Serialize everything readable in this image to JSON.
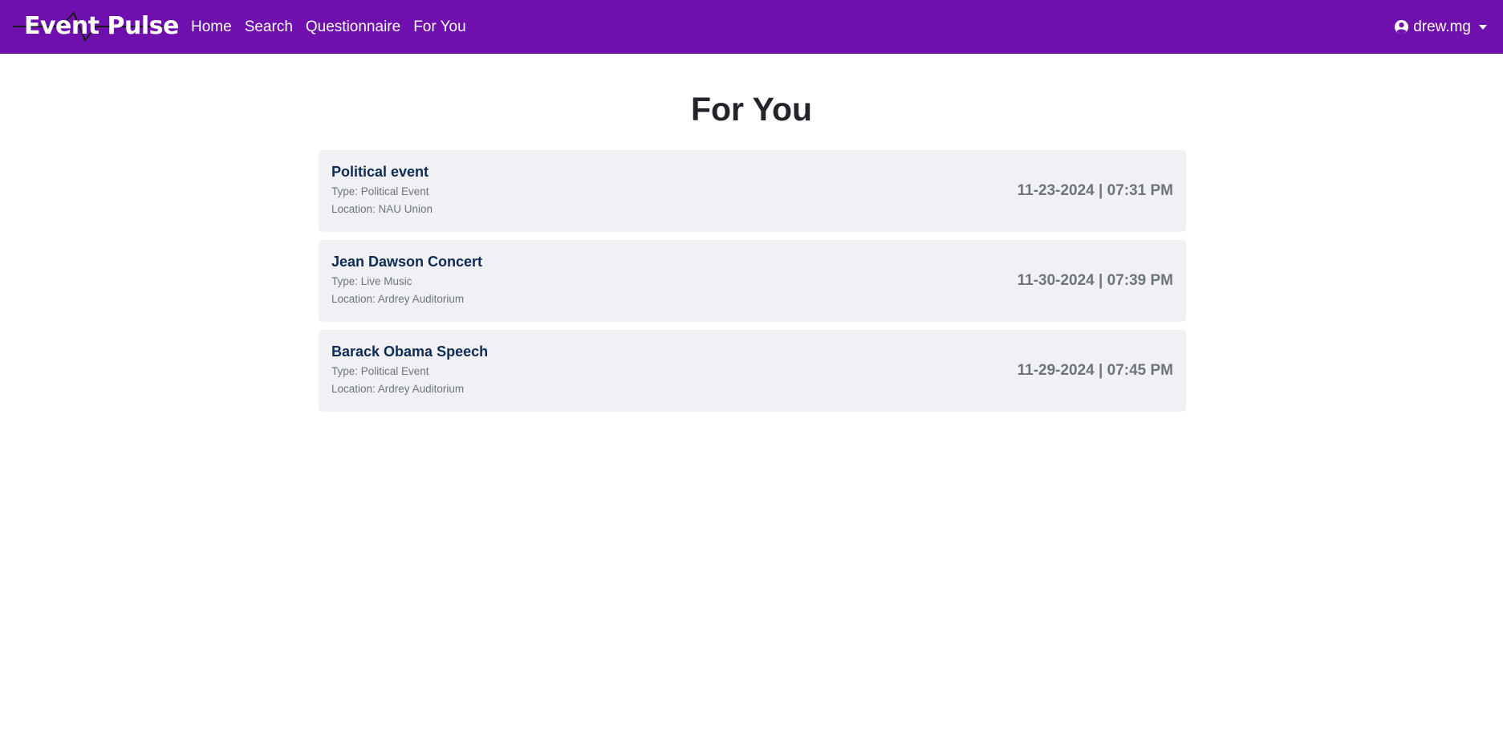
{
  "navbar": {
    "brand": "Event Pulse",
    "links": [
      {
        "label": "Home"
      },
      {
        "label": "Search"
      },
      {
        "label": "Questionnaire"
      },
      {
        "label": "For You"
      }
    ],
    "user": {
      "name": "drew.mg",
      "icon": "user-circle-icon"
    },
    "background_color": "#6f0fae"
  },
  "page": {
    "title": "For You"
  },
  "events": [
    {
      "title": "Political event",
      "type": "Type: Political Event",
      "location": "Location: NAU Union",
      "datetime": "11-23-2024 | 07:31 PM"
    },
    {
      "title": "Jean Dawson Concert",
      "type": "Type: Live Music",
      "location": "Location: Ardrey Auditorium",
      "datetime": "11-30-2024 | 07:39 PM"
    },
    {
      "title": "Barack Obama Speech",
      "type": "Type: Political Event",
      "location": "Location: Ardrey Auditorium",
      "datetime": "11-29-2024 | 07:45 PM"
    }
  ]
}
